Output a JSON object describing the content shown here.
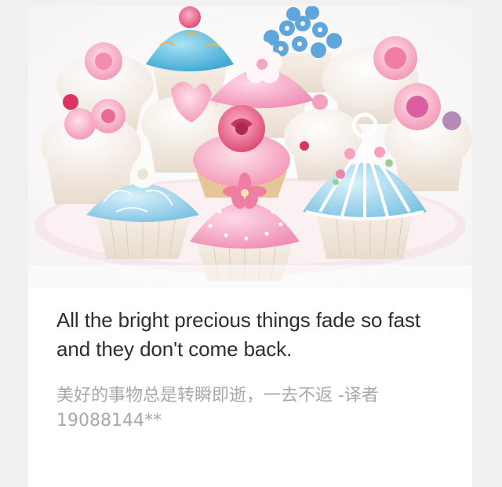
{
  "hero_image": {
    "subject": "cupcakes",
    "colors": {
      "pink": "#f3a6c5",
      "blue": "#86c9e6",
      "cream": "#fbf4ec",
      "wrapper": "#f2e7dc",
      "rose": "#e2577f"
    }
  },
  "quote": {
    "text": "All the bright precious things fade so fast and they don't come back."
  },
  "translation": {
    "text": "美好的事物总是转瞬即逝，一去不返 -译者 19088144**"
  }
}
